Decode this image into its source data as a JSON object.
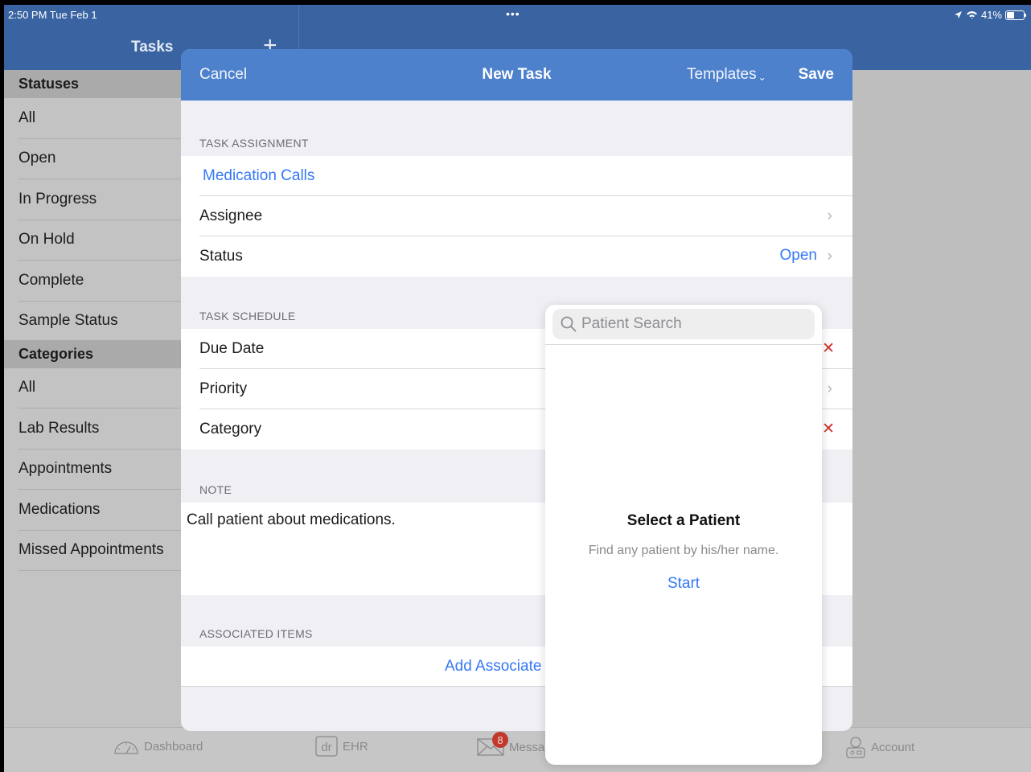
{
  "status_bar": {
    "time": "2:50 PM  Tue Feb 1",
    "dots": "•••",
    "battery_text": "41%"
  },
  "header": {
    "title": "Tasks",
    "add_label": "+"
  },
  "sidebar": {
    "statuses_heading": "Statuses",
    "statuses": [
      "All",
      "Open",
      "In Progress",
      "On Hold",
      "Complete",
      "Sample Status"
    ],
    "categories_heading": "Categories",
    "categories": [
      "All",
      "Lab Results",
      "Appointments",
      "Medications",
      "Missed Appointments"
    ]
  },
  "tabbar": {
    "dashboard": "Dashboard",
    "ehr": "EHR",
    "messages": "Messa",
    "messages_badge": "8",
    "account": "Account"
  },
  "modal": {
    "cancel": "Cancel",
    "title": "New Task",
    "templates": "Templates",
    "save": "Save",
    "task_assignment_label": "TASK ASSIGNMENT",
    "template_name": "Medication Calls",
    "assignee_label": "Assignee",
    "status_label": "Status",
    "status_value": "Open",
    "task_schedule_label": "TASK SCHEDULE",
    "due_date_label": "Due Date",
    "priority_label": "Priority",
    "category_label": "Category",
    "note_section_label": "NOTE",
    "note_text": "Call patient about medications.",
    "associated_items_label": "ASSOCIATED ITEMS",
    "add_associated": "Add Associate"
  },
  "popover": {
    "search_placeholder": "Patient Search",
    "empty_title": "Select a Patient",
    "empty_subtitle": "Find any patient by his/her name.",
    "start": "Start"
  },
  "colors": {
    "brand_blue": "#4e81cc",
    "header_blue": "#3a63a2",
    "link_blue": "#3478f6",
    "destructive_red": "#d0342c"
  }
}
